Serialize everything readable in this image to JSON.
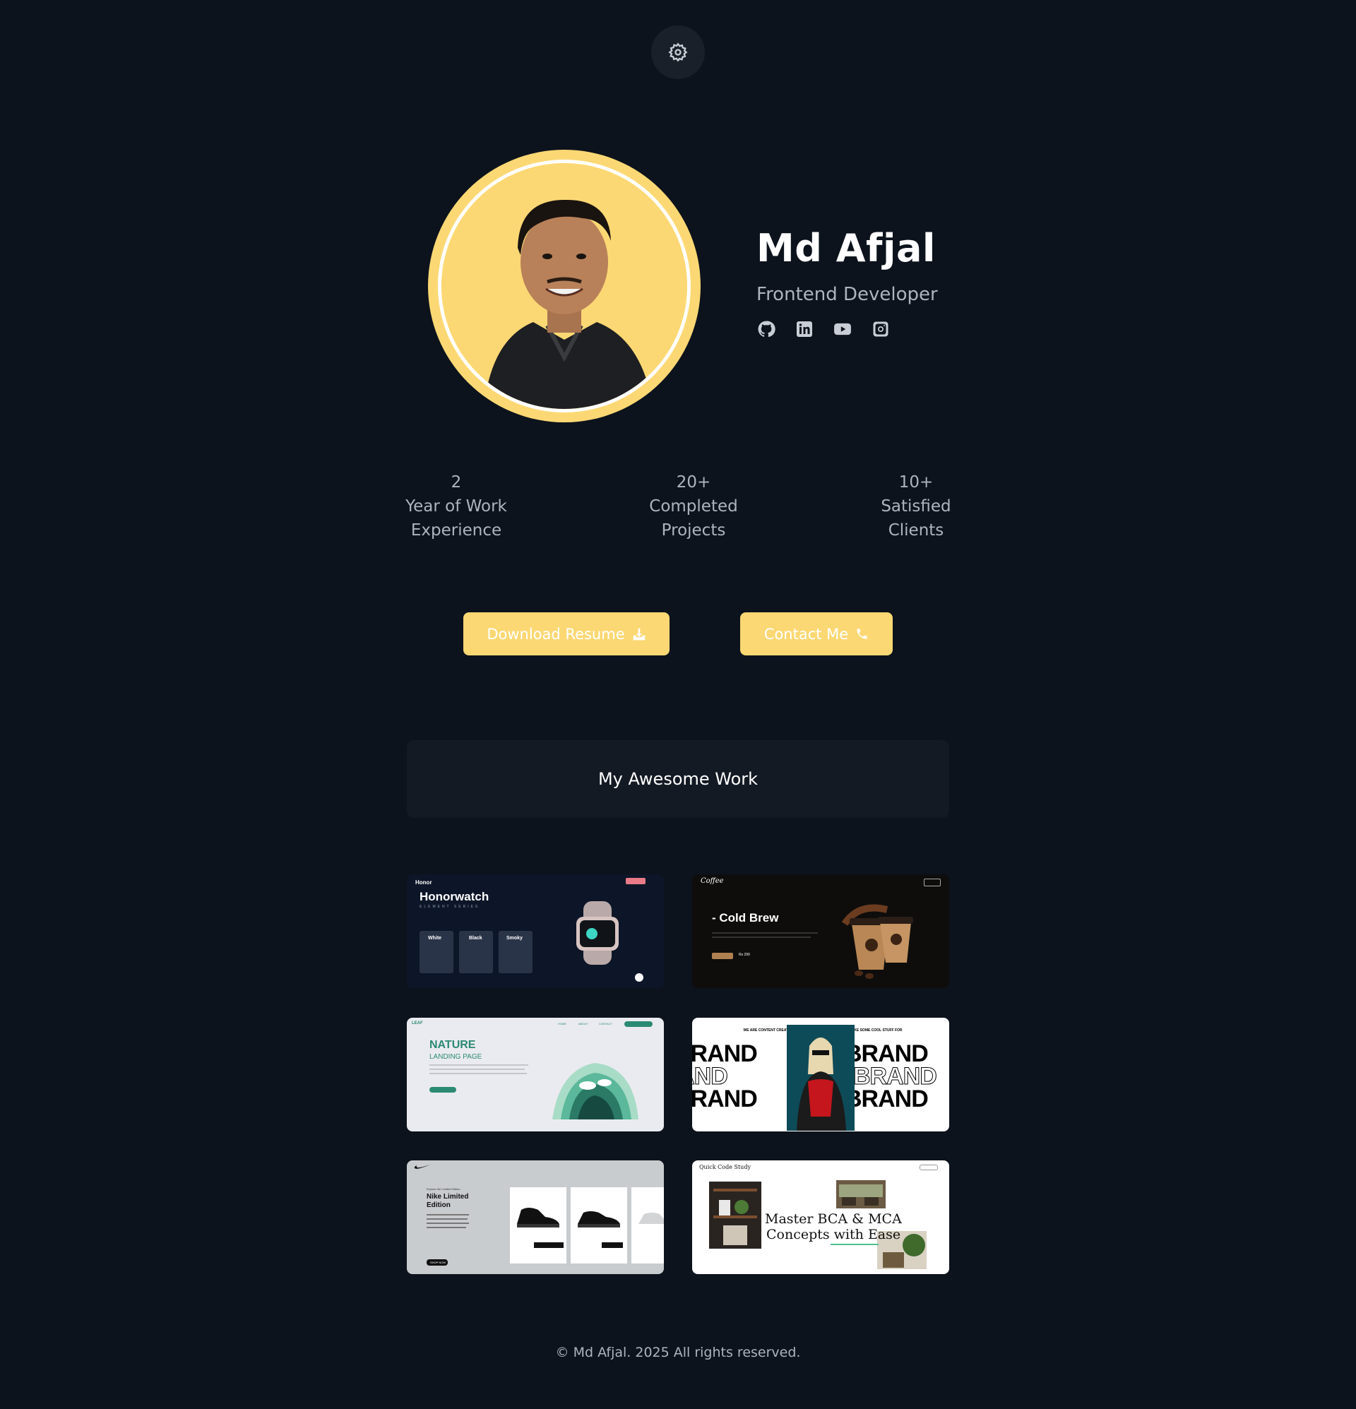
{
  "hero": {
    "name": "Md Afjal",
    "role": "Frontend Developer",
    "socials": [
      "github-icon",
      "linkedin-icon",
      "youtube-icon",
      "instagram-icon"
    ]
  },
  "stats": [
    {
      "value": "2",
      "label": "Year of Work Experience"
    },
    {
      "value": "20+",
      "label": "Completed Projects"
    },
    {
      "value": "10+",
      "label": "Satisfied Clients"
    }
  ],
  "buttons": {
    "resume": "Download Resume",
    "contact": "Contact Me"
  },
  "section": {
    "title": "My Awesome Work"
  },
  "projects": {
    "honor": {
      "brand": "Honor",
      "title": "Honorwatch",
      "subtitle": "ELEMENT SERIES",
      "variants": [
        "White",
        "Black",
        "Smoky"
      ]
    },
    "coffee": {
      "logo": "Coffee",
      "title": "- Cold Brew",
      "price": "Rs 299"
    },
    "nature": {
      "logo": "LEAF",
      "title": "NATURE",
      "subtitle": "LANDING PAGE",
      "nav": [
        "HOME",
        "ABOUT",
        "CONTACT"
      ],
      "cta": "LOGIN"
    },
    "brand": {
      "tagline": "WE ARE CONTENT CREATION TEAM AND WE ARE GOING TO MAKE SOME COOL STUFF FOR YOUR",
      "word": "BRAND"
    },
    "nike": {
      "title": "Nike Limited Edition",
      "eyebrow": "Explore the Limited Edition",
      "cta": "SHOP NOW"
    },
    "study": {
      "logo": "Quick Code Study",
      "headline_1": "Master BCA & MCA",
      "headline_2": "Concepts with Ease"
    }
  },
  "footer": {
    "text": "© Md Afjal. 2025 All rights reserved."
  },
  "colors": {
    "background": "#0d131c",
    "accent": "#fcd874",
    "panel": "#141a23",
    "muted": "#aeb4bd"
  }
}
